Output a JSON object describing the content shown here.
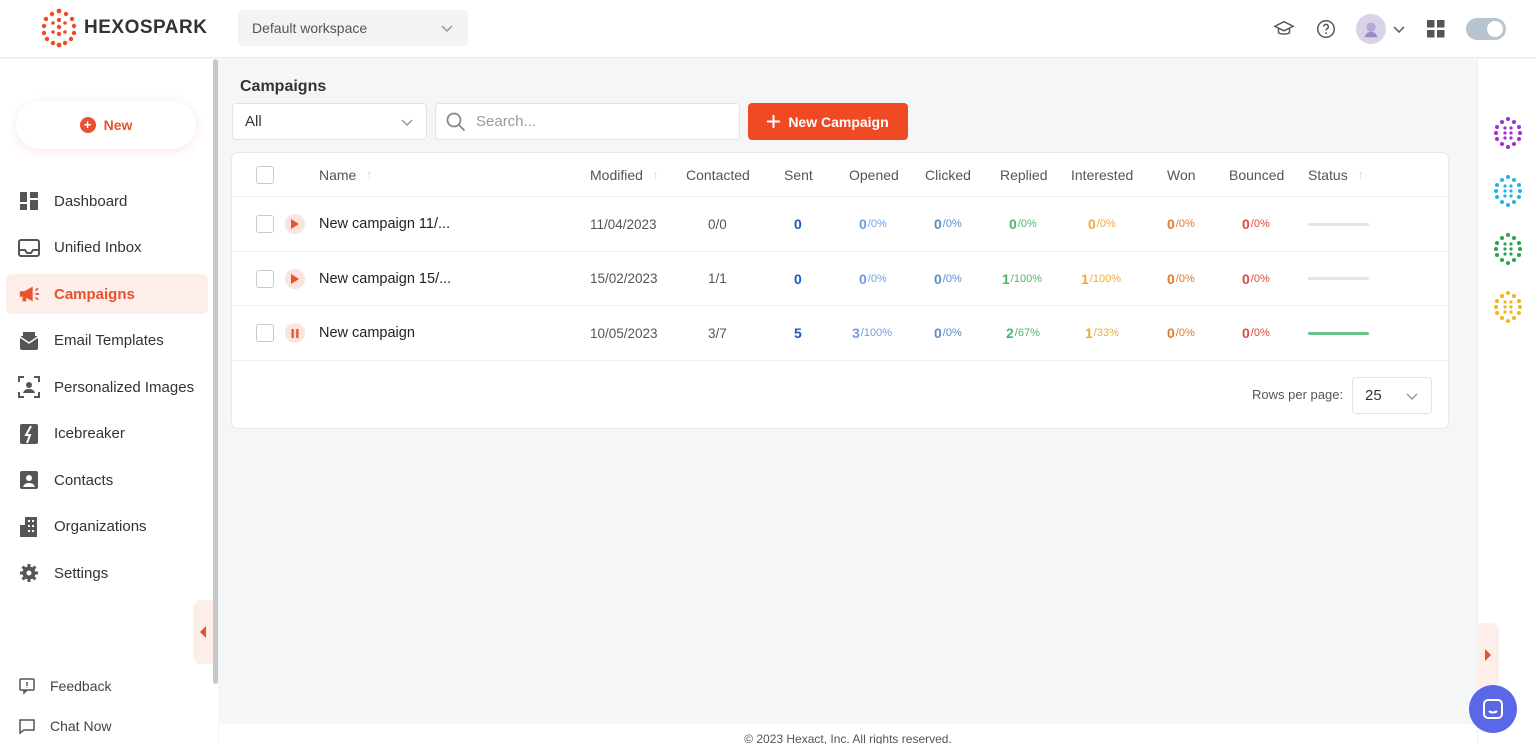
{
  "brand": {
    "name": "HEXOSPARK",
    "accent": "#f04a24"
  },
  "workspace": {
    "selected": "Default workspace"
  },
  "header_icons": [
    "graduation-cap-icon",
    "help-circle-icon",
    "avatar",
    "chevron-down-icon",
    "apps-grid-icon",
    "theme-toggle"
  ],
  "sidebar": {
    "new_label": "New",
    "items": [
      {
        "label": "Dashboard",
        "icon": "dashboard-icon",
        "active": false
      },
      {
        "label": "Unified Inbox",
        "icon": "inbox-icon",
        "active": false
      },
      {
        "label": "Campaigns",
        "icon": "megaphone-icon",
        "active": true
      },
      {
        "label": "Email Templates",
        "icon": "email-template-icon",
        "active": false
      },
      {
        "label": "Personalized Images",
        "icon": "person-frame-icon",
        "active": false
      },
      {
        "label": "Icebreaker",
        "icon": "icebreaker-icon",
        "active": false
      },
      {
        "label": "Contacts",
        "icon": "contact-icon",
        "active": false
      },
      {
        "label": "Organizations",
        "icon": "building-icon",
        "active": false
      },
      {
        "label": "Settings",
        "icon": "gear-icon",
        "active": false
      }
    ],
    "feedback_label": "Feedback",
    "chat_label": "Chat Now"
  },
  "main": {
    "title": "Campaigns",
    "filter": {
      "selected": "All"
    },
    "search": {
      "placeholder": "Search...",
      "value": ""
    },
    "new_campaign_label": "New Campaign",
    "table": {
      "headers": {
        "name": "Name",
        "modified": "Modified",
        "contacted": "Contacted",
        "sent": "Sent",
        "opened": "Opened",
        "clicked": "Clicked",
        "replied": "Replied",
        "interested": "Interested",
        "won": "Won",
        "bounced": "Bounced",
        "status": "Status"
      },
      "rows": [
        {
          "name": "New campaign 11/...",
          "state": "play",
          "modified": "11/04/2023",
          "contacted": "0/0",
          "sent": "0",
          "opened": {
            "n": "0",
            "p": "/0%"
          },
          "clicked": {
            "n": "0",
            "p": "/0%"
          },
          "replied": {
            "n": "0",
            "p": "/0%"
          },
          "interested": {
            "n": "0",
            "p": "/0%"
          },
          "won": {
            "n": "0",
            "p": "/0%"
          },
          "bounced": {
            "n": "0",
            "p": "/0%"
          },
          "progress": 0
        },
        {
          "name": "New campaign 15/...",
          "state": "play",
          "modified": "15/02/2023",
          "contacted": "1/1",
          "sent": "0",
          "opened": {
            "n": "0",
            "p": "/0%"
          },
          "clicked": {
            "n": "0",
            "p": "/0%"
          },
          "replied": {
            "n": "1",
            "p": "/100%"
          },
          "interested": {
            "n": "1",
            "p": "/100%"
          },
          "won": {
            "n": "0",
            "p": "/0%"
          },
          "bounced": {
            "n": "0",
            "p": "/0%"
          },
          "progress": 0
        },
        {
          "name": "New campaign",
          "state": "pause",
          "modified": "10/05/2023",
          "contacted": "3/7",
          "sent": "5",
          "opened": {
            "n": "3",
            "p": "/100%"
          },
          "clicked": {
            "n": "0",
            "p": "/0%"
          },
          "replied": {
            "n": "2",
            "p": "/67%"
          },
          "interested": {
            "n": "1",
            "p": "/33%"
          },
          "won": {
            "n": "0",
            "p": "/0%"
          },
          "bounced": {
            "n": "0",
            "p": "/0%"
          },
          "progress": 1
        }
      ]
    },
    "pagination": {
      "rows_per_page_label": "Rows per page:",
      "rows_per_page": "25"
    }
  },
  "metric_colors": {
    "sent": "#1a56c8",
    "opened": "#6f9ee0",
    "clicked": "#5a8ec9",
    "replied": "#4fb56d",
    "interested": "#f2a93b",
    "won": "#e07a2c",
    "bounced": "#e0473a"
  },
  "right_rail": {
    "apps": [
      "purple-app-icon",
      "blue-app-icon",
      "green-app-icon",
      "yellow-app-icon"
    ]
  },
  "footer": {
    "text": "© 2023 Hexact, Inc. All rights reserved."
  }
}
